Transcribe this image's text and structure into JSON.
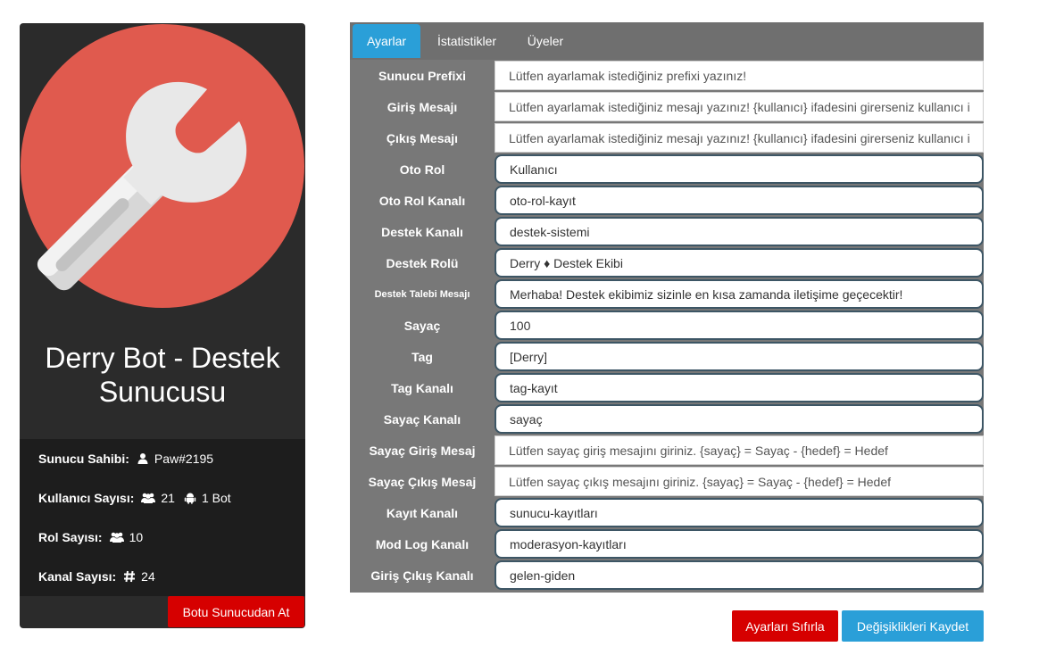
{
  "server": {
    "name": "Derry Bot - Destek Sunucusu",
    "avatar_icon": "wrench-icon",
    "avatar_color": "#e05a4e",
    "owner_label": "Sunucu Sahibi:",
    "owner_value": "Paw#2195",
    "users_label": "Kullanıcı Sayısı:",
    "users_value": "21",
    "bots_value": "1 Bot",
    "roles_label": "Rol Sayısı:",
    "roles_value": "10",
    "channels_label": "Kanal Sayısı:",
    "channels_value": "24",
    "kick_label": "Botu Sunucudan At"
  },
  "tabs": [
    {
      "label": "Ayarlar",
      "active": true
    },
    {
      "label": "İstatistikler",
      "active": false
    },
    {
      "label": "Üyeler",
      "active": false
    }
  ],
  "settings": [
    {
      "label": "Sunucu Prefixi",
      "value": "",
      "placeholder": "Lütfen ayarlamak istediğiniz prefixi yazınız!"
    },
    {
      "label": "Giriş Mesajı",
      "value": "",
      "placeholder": "Lütfen ayarlamak istediğiniz mesajı yazınız! {kullanıcı} ifadesini girerseniz kullanıcı i"
    },
    {
      "label": "Çıkış Mesajı",
      "value": "",
      "placeholder": "Lütfen ayarlamak istediğiniz mesajı yazınız! {kullanıcı} ifadesini girerseniz kullanıcı i"
    },
    {
      "label": "Oto Rol",
      "value": "Kullanıcı",
      "placeholder": ""
    },
    {
      "label": "Oto Rol Kanalı",
      "value": "oto-rol-kayıt",
      "placeholder": ""
    },
    {
      "label": "Destek Kanalı",
      "value": "destek-sistemi",
      "placeholder": ""
    },
    {
      "label": "Destek Rolü",
      "value": "Derry ♦ Destek Ekibi",
      "placeholder": ""
    },
    {
      "label": "Destek Talebi Mesajı",
      "value": "Merhaba! Destek ekibimiz sizinle en kısa zamanda iletişime geçecektir!",
      "placeholder": ""
    },
    {
      "label": "Sayaç",
      "value": "100",
      "placeholder": ""
    },
    {
      "label": "Tag",
      "value": "[Derry]",
      "placeholder": ""
    },
    {
      "label": "Tag Kanalı",
      "value": "tag-kayıt",
      "placeholder": ""
    },
    {
      "label": "Sayaç Kanalı",
      "value": "sayaç",
      "placeholder": ""
    },
    {
      "label": "Sayaç Giriş Mesaj",
      "value": "",
      "placeholder": "Lütfen sayaç giriş mesajını giriniz. {sayaç} = Sayaç - {hedef} = Hedef"
    },
    {
      "label": "Sayaç Çıkış Mesaj",
      "value": "",
      "placeholder": "Lütfen sayaç çıkış mesajını giriniz. {sayaç} = Sayaç - {hedef} = Hedef"
    },
    {
      "label": "Kayıt Kanalı",
      "value": "sunucu-kayıtları",
      "placeholder": ""
    },
    {
      "label": "Mod Log Kanalı",
      "value": "moderasyon-kayıtları",
      "placeholder": ""
    },
    {
      "label": "Giriş Çıkış Kanalı",
      "value": "gelen-giden",
      "placeholder": ""
    }
  ],
  "actions": {
    "reset_label": "Ayarları Sıfırla",
    "save_label": "Değişiklikleri Kaydet"
  },
  "colors": {
    "accent": "#2a9fd8",
    "danger": "#d60000"
  }
}
